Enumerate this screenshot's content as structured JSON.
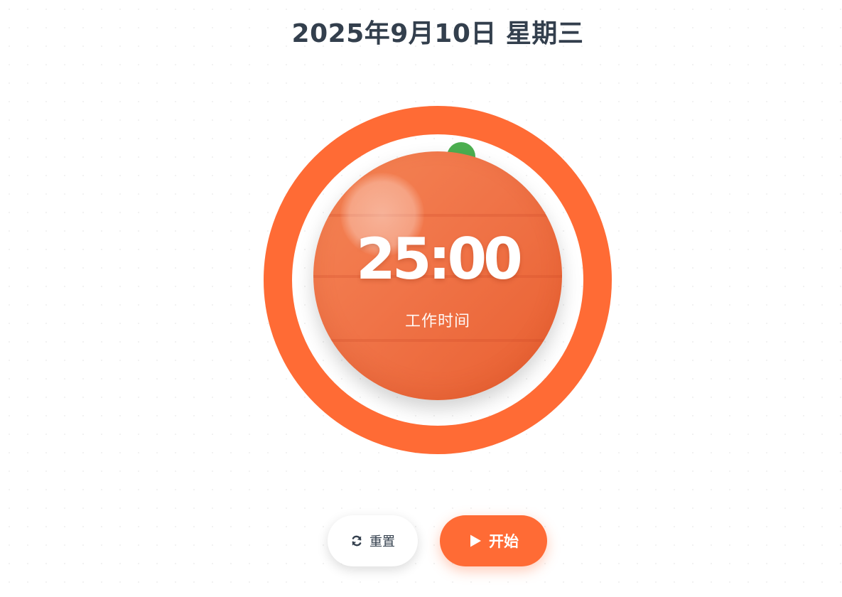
{
  "header": {
    "date_text": "2025年9月10日 星期三"
  },
  "timer": {
    "time_text": "25:00",
    "mode_label": "工作时间",
    "progress": 1.0,
    "ring_color": "#ff6b35",
    "stem_color": "#4caf50"
  },
  "controls": {
    "reset": {
      "label": "重置",
      "icon": "refresh-icon"
    },
    "start": {
      "label": "开始",
      "icon": "play-icon",
      "color": "#ff6b35"
    }
  }
}
